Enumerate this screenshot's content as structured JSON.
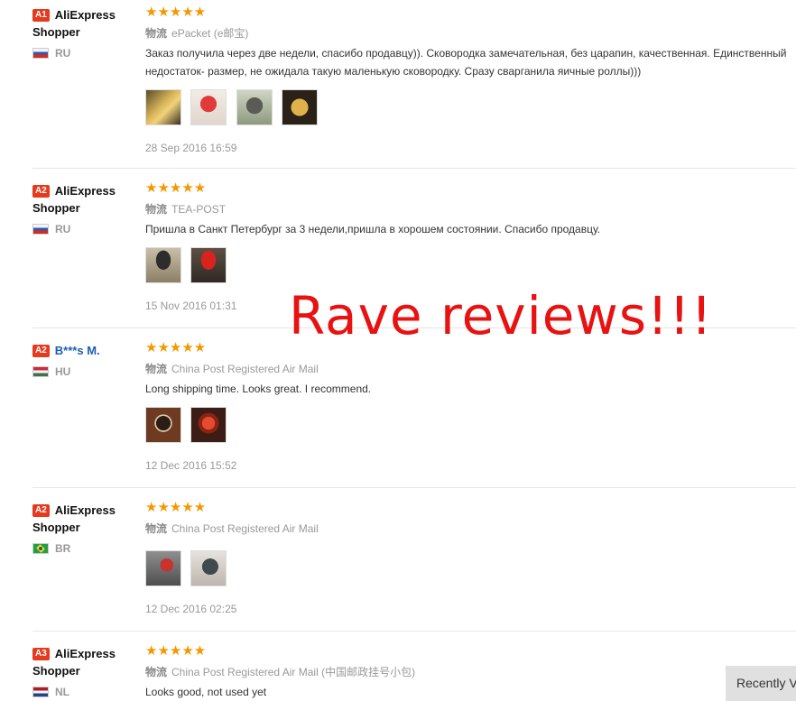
{
  "reviews": [
    {
      "level": "A1",
      "name": "AliExpress Shopper",
      "country": "RU",
      "flag": "ru",
      "stars": "★★★★★",
      "rating": 5,
      "ship_label": "物流",
      "shipping": "ePacket (e邮宝)",
      "text": "Заказ получила через две недели, спасибо продавцу)). Сковородка замечательная, без царапин, качественная. Единственный недостаток- размер, не ожидала такую маленькую сковородку. Сразу сварганила яичные роллы)))",
      "date": "28 Sep 2016 16:59",
      "photos": 4
    },
    {
      "level": "A2",
      "name": "AliExpress Shopper",
      "country": "RU",
      "flag": "ru",
      "stars": "★★★★★",
      "rating": 5,
      "ship_label": "物流",
      "shipping": "TEA-POST",
      "text": "Пришла в Санкт Петербург за 3 недели,пришла в хорошем состоянии. Спасибо продавцу.",
      "date": "15 Nov 2016 01:31",
      "photos": 2
    },
    {
      "level": "A2",
      "name": "B***s M.",
      "country": "HU",
      "flag": "hu",
      "stars": "★★★★★",
      "rating": 5,
      "ship_label": "物流",
      "shipping": "China Post Registered Air Mail",
      "text": "Long shipping time. Looks great. I recommend.",
      "date": "12 Dec 2016 15:52",
      "photos": 2
    },
    {
      "level": "A2",
      "name": "AliExpress Shopper",
      "country": "BR",
      "flag": "br",
      "stars": "★★★★★",
      "rating": 5,
      "ship_label": "物流",
      "shipping": "China Post Registered Air Mail",
      "text": "",
      "date": "12 Dec 2016 02:25",
      "photos": 2
    },
    {
      "level": "A3",
      "name": "AliExpress Shopper",
      "country": "NL",
      "flag": "nl",
      "stars": "★★★★★",
      "rating": 5,
      "ship_label": "物流",
      "shipping": "China Post Registered Air Mail (中国邮政挂号小包)",
      "text": "Looks good, not used yet",
      "date": "",
      "photos": 0
    }
  ],
  "overlay_text": "Rave reviews!!!",
  "recently_viewed": "Recently Viewed",
  "colors": {
    "star": "#f39800",
    "badge": "#e43a1e",
    "overlay": "#e81212",
    "link": "#1a5db6"
  }
}
